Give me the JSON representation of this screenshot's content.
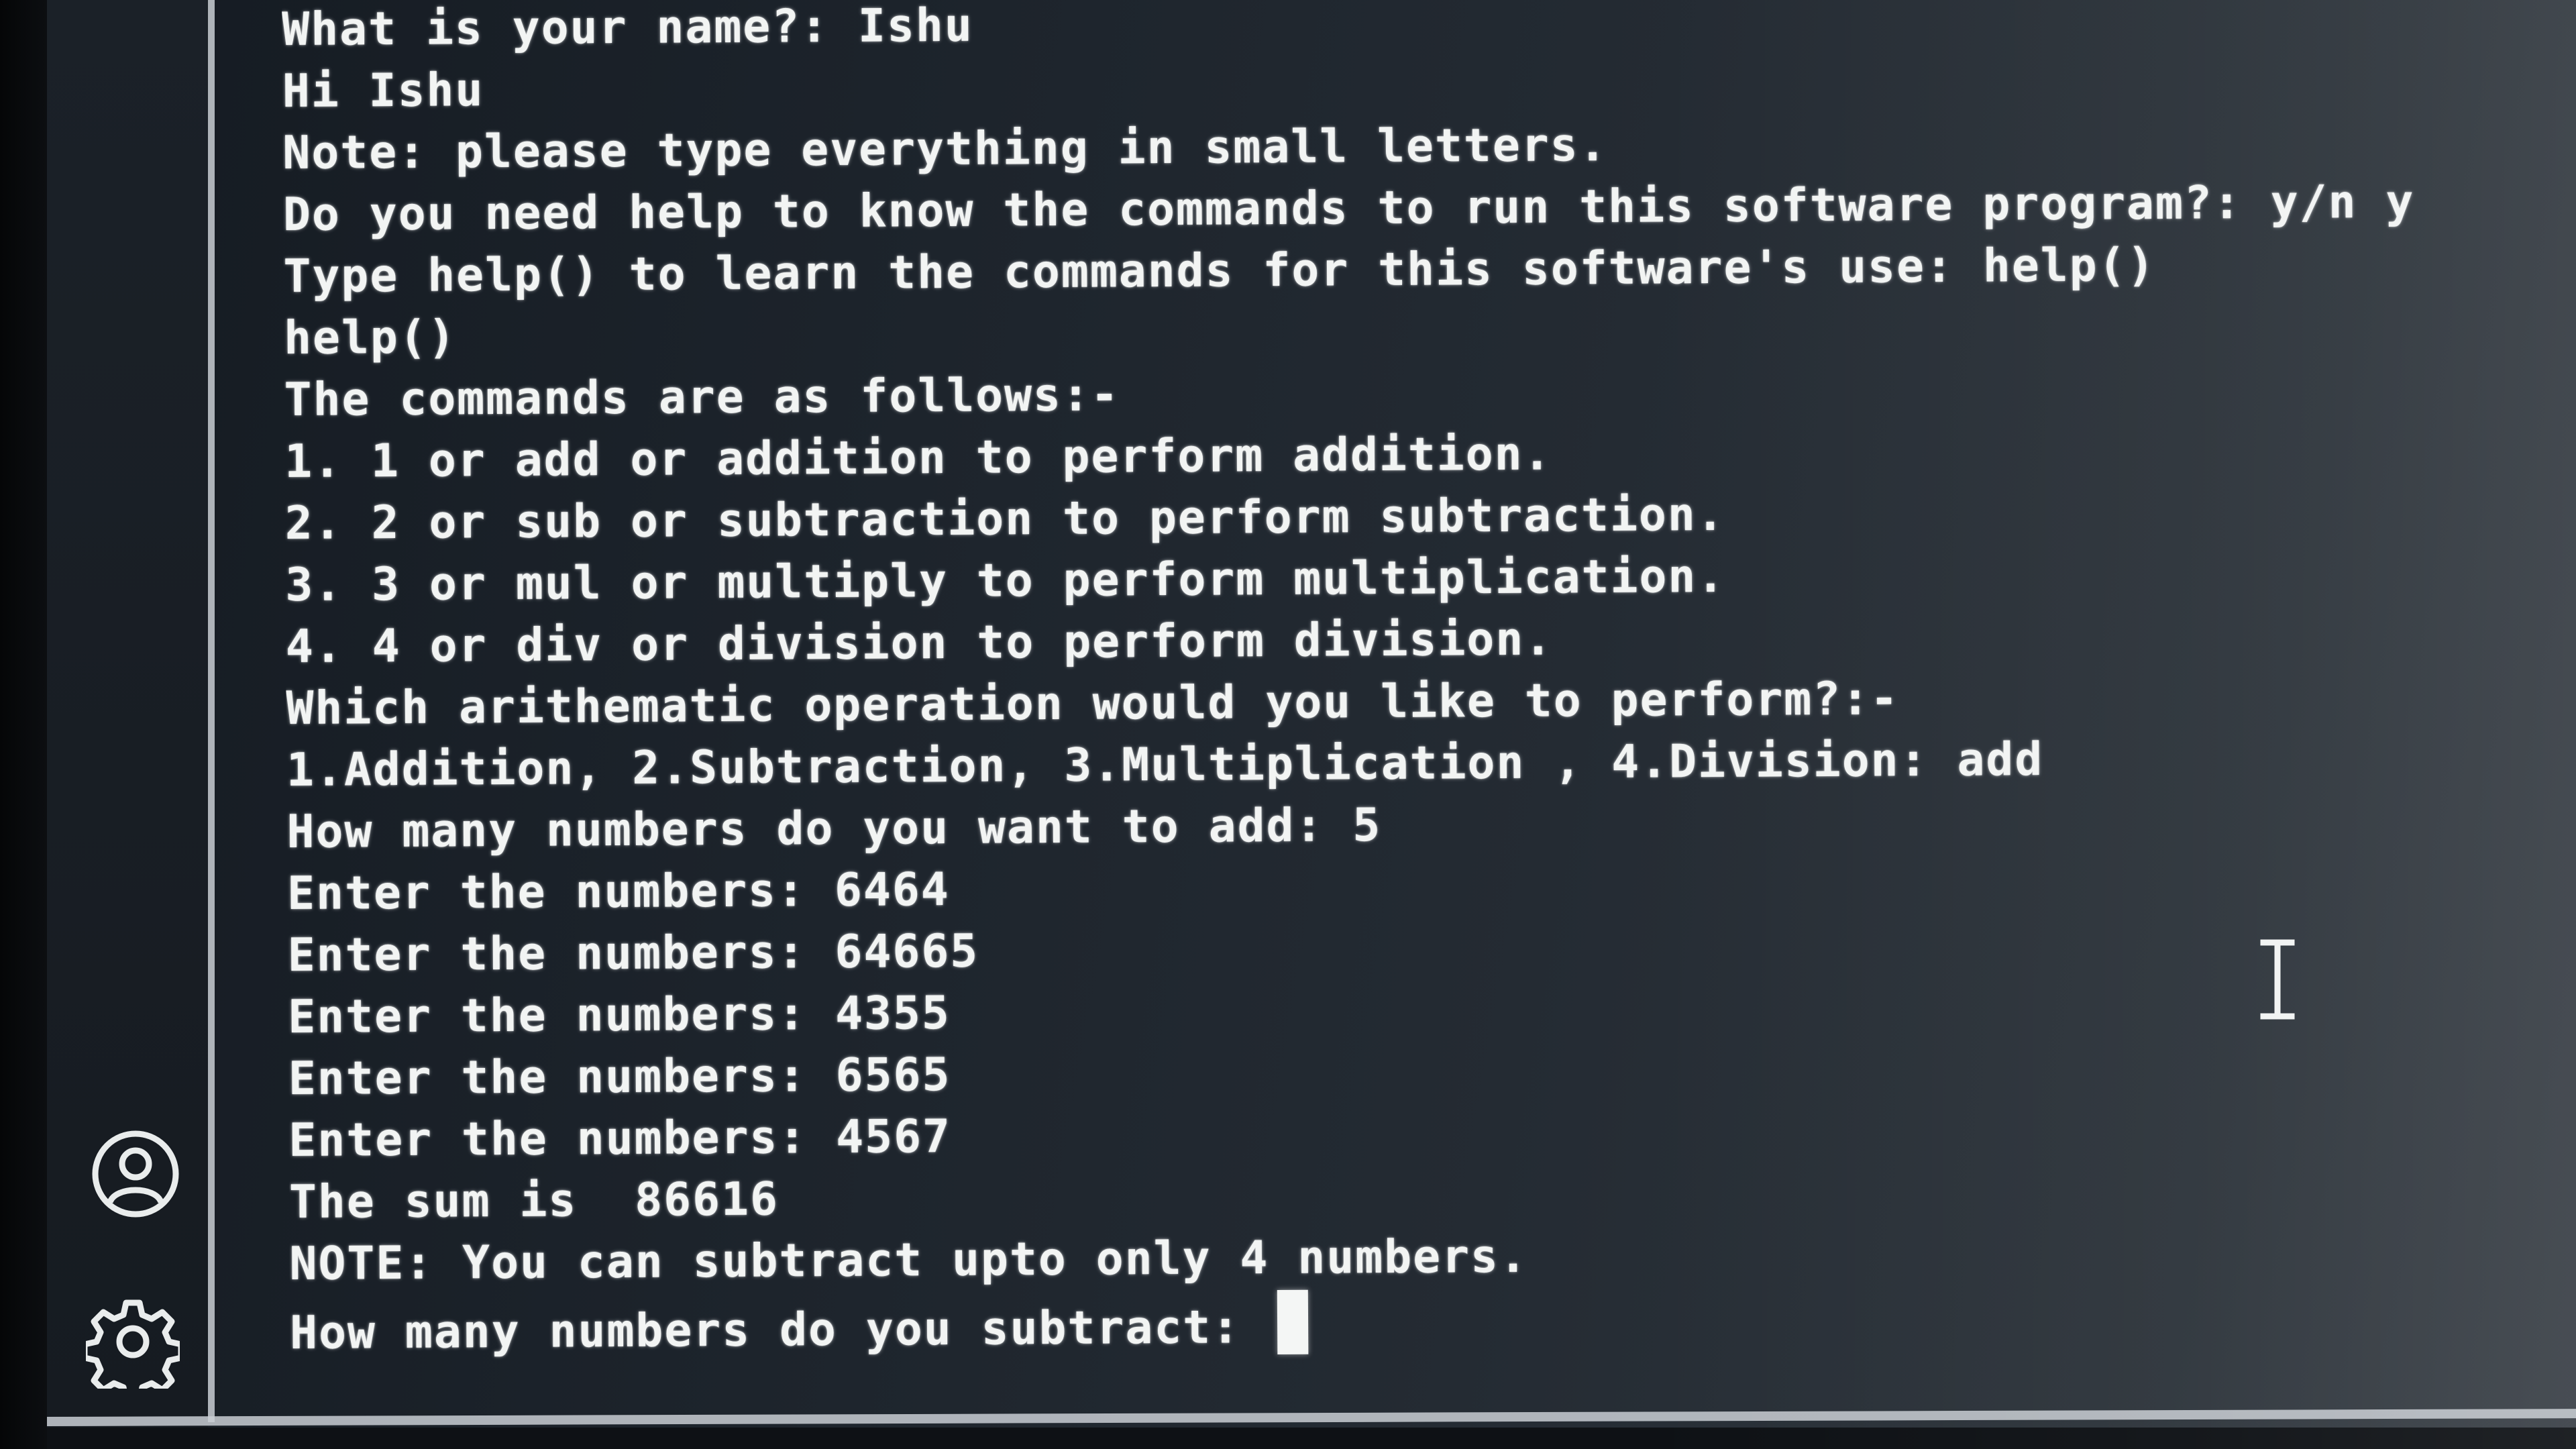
{
  "terminal": {
    "lines": [
      "What is your name?: Ishu",
      "Hi Ishu",
      "Note: please type everything in small letters.",
      "Do you need help to know the commands to run this software program?: y/n y",
      "Type help() to learn the commands for this software's use: help()",
      "help()",
      "The commands are as follows:-",
      "1. 1 or add or addition to perform addition.",
      "2. 2 or sub or subtraction to perform subtraction.",
      "3. 3 or mul or multiply to perform multiplication.",
      "4. 4 or div or division to perform division.",
      "Which arithematic operation would you like to perform?:-",
      "1.Addition, 2.Subtraction, 3.Multiplication , 4.Division: add",
      "How many numbers do you want to add: 5",
      "Enter the numbers: 6464",
      "Enter the numbers: 64665",
      "Enter the numbers: 4355",
      "Enter the numbers: 6565",
      "Enter the numbers: 4567",
      "The sum is  86616",
      "NOTE: You can subtract upto only 4 numbers.",
      "How many numbers do you subtract: "
    ]
  },
  "activity_bar": {
    "icons": [
      "account-icon",
      "settings-gear-icon"
    ]
  },
  "colors": {
    "text": "#f2f4f3",
    "background": "#1d242c",
    "sidebar": "#1b2128",
    "divider": "#c9ced3"
  }
}
